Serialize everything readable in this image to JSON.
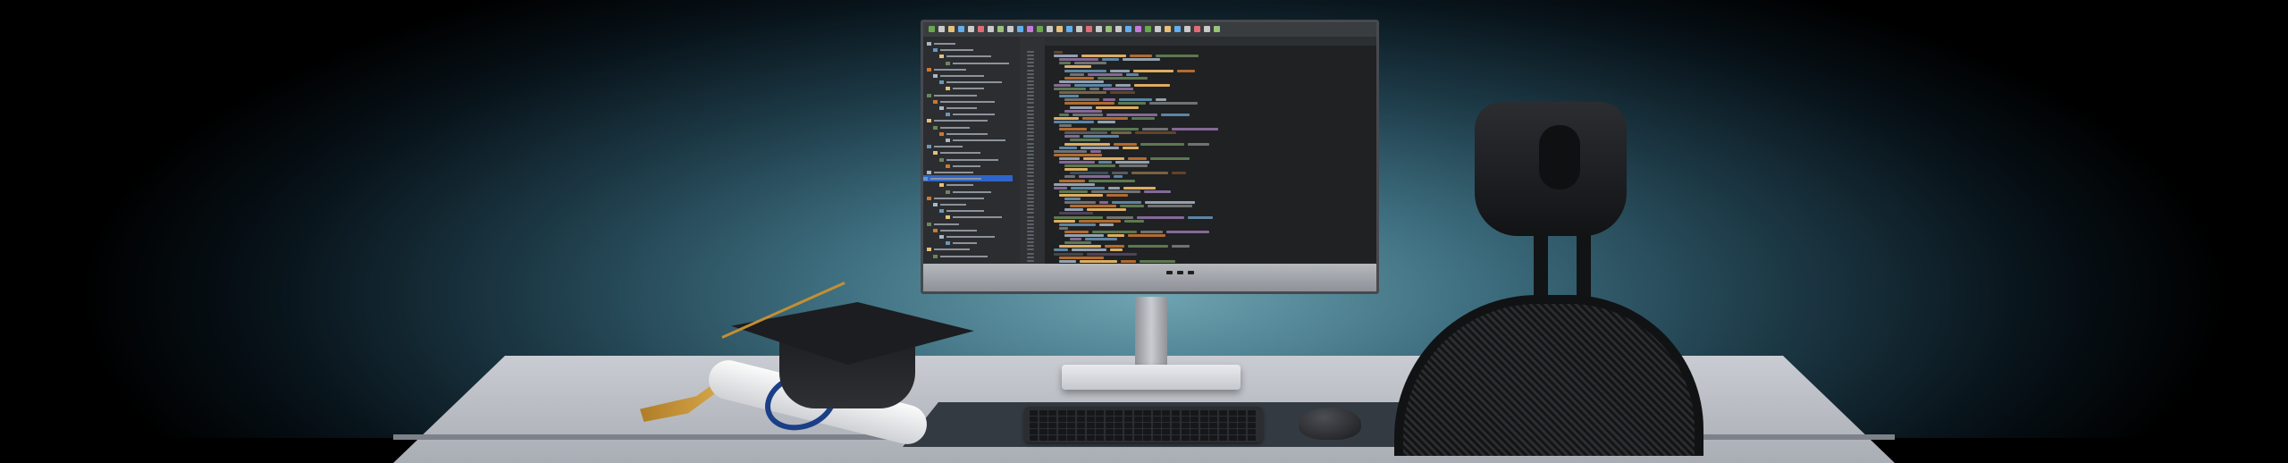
{
  "scene": {
    "description_label": "",
    "monitor": {
      "ide_tab_title": "",
      "brand_mark": ""
    }
  },
  "colors": {
    "background_center": "#6fa4b2",
    "background_edge": "#000000",
    "desk_top": "#c9ccd2",
    "monitor_bezel": "#47494e",
    "ide_background": "#1f2123",
    "ide_panel": "#2b2d30",
    "keyword_orange": "#cc7832",
    "string_green": "#6a8759",
    "field_purple": "#9876aa",
    "ribbon_blue": "#1b3f86",
    "tassel_gold": "#c38f32"
  },
  "icons": [
    "monitor-icon",
    "keyboard-icon",
    "mouse-icon",
    "graduation-cap-icon",
    "diploma-icon",
    "office-chair-icon"
  ]
}
